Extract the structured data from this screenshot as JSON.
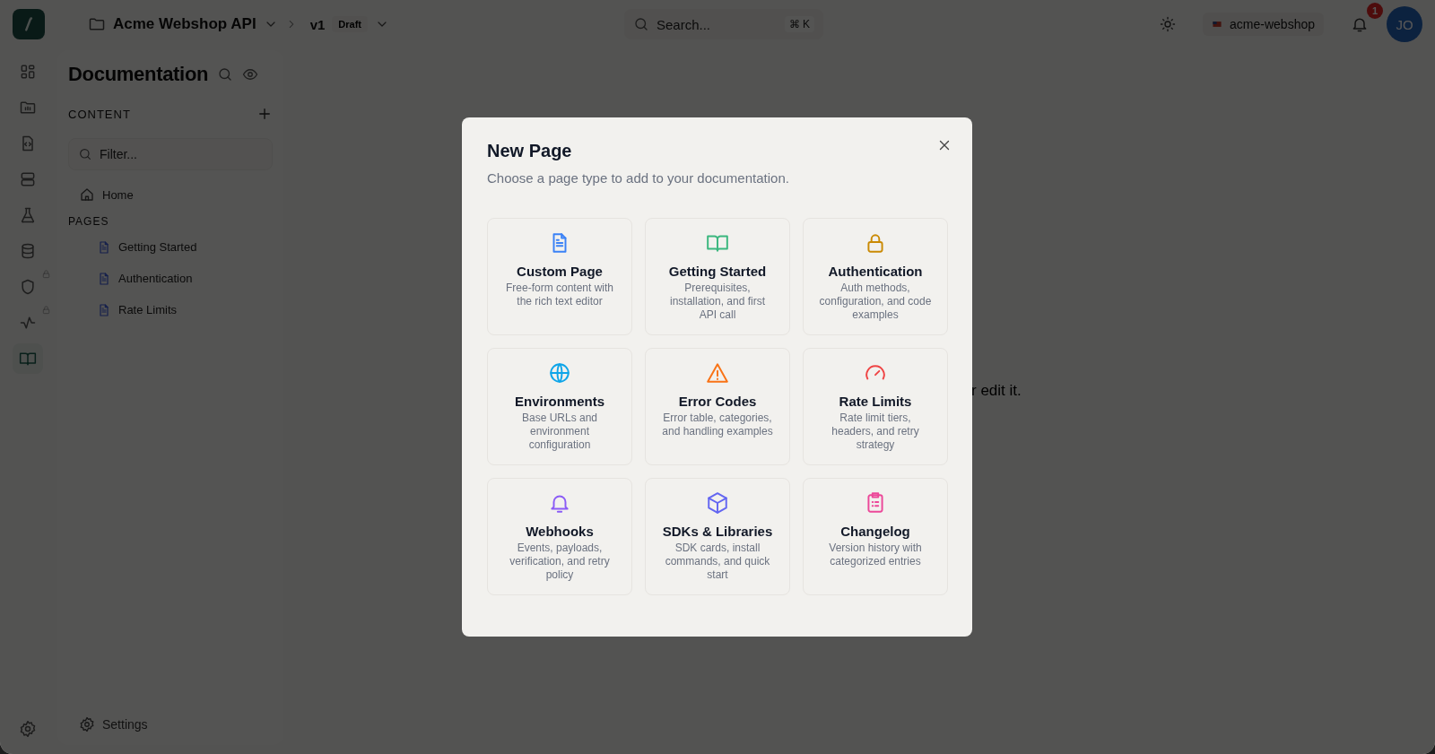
{
  "topbar": {
    "project": "Acme Webshop API",
    "version": "v1",
    "version_status": "Draft",
    "search_placeholder": "Search...",
    "shortcut": "⌘ K",
    "workspace": "acme-webshop",
    "notification_count": "1",
    "avatar": "JO"
  },
  "rail": [
    {
      "selected": false,
      "locked": false
    },
    {
      "selected": false,
      "locked": false
    },
    {
      "selected": false,
      "locked": false
    },
    {
      "selected": false,
      "locked": false
    },
    {
      "selected": false,
      "locked": false
    },
    {
      "selected": false,
      "locked": false
    },
    {
      "selected": false,
      "locked": true
    },
    {
      "selected": false,
      "locked": true
    },
    {
      "selected": true,
      "locked": false
    }
  ],
  "sidebar": {
    "title": "Documentation",
    "section": "CONTENT",
    "filter_placeholder": "Filter...",
    "home": "Home",
    "pages_heading": "PAGES",
    "pages": [
      "Getting Started",
      "Authentication",
      "Rate Limits"
    ],
    "settings": "Settings"
  },
  "main": {
    "hint": "r edit it."
  },
  "modal": {
    "title": "New Page",
    "subtitle": "Choose a page type to add to your documentation.",
    "cards": [
      {
        "title": "Custom Page",
        "description": "Free-form content with the rich text editor",
        "color": "#3b82f6"
      },
      {
        "title": "Getting Started",
        "description": "Prerequisites, installation, and first API call",
        "color": "#3bb77e"
      },
      {
        "title": "Authentication",
        "description": "Auth methods, configuration, and code examples",
        "color": "#ca8a04"
      },
      {
        "title": "Environments",
        "description": "Base URLs and environment configuration",
        "color": "#0ea5e9"
      },
      {
        "title": "Error Codes",
        "description": "Error table, categories, and handling examples",
        "color": "#f97316"
      },
      {
        "title": "Rate Limits",
        "description": "Rate limit tiers, headers, and retry strategy",
        "color": "#ef4444"
      },
      {
        "title": "Webhooks",
        "description": "Events, payloads, verification, and retry policy",
        "color": "#8b5cf6"
      },
      {
        "title": "SDKs & Libraries",
        "description": "SDK cards, install commands, and quick start",
        "color": "#6366f1"
      },
      {
        "title": "Changelog",
        "description": "Version history with categorized entries",
        "color": "#ec4899"
      }
    ]
  }
}
